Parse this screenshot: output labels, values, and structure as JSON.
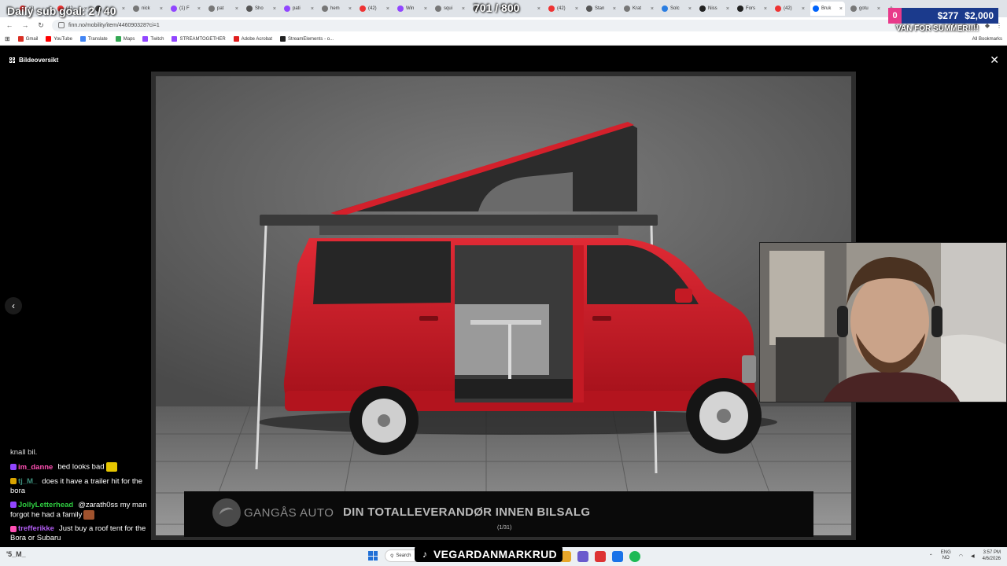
{
  "browser": {
    "tabs": [
      {
        "label": "(3)",
        "color": "#e33"
      },
      {
        "label": "(42",
        "color": "#e33"
      },
      {
        "label": "",
        "color": "#444"
      },
      {
        "label": "nick",
        "color": "#777"
      },
      {
        "label": "(1) F",
        "color": "#9146ff"
      },
      {
        "label": "pat",
        "color": "#777"
      },
      {
        "label": "Sho",
        "color": "#555"
      },
      {
        "label": "pati",
        "color": "#9146ff"
      },
      {
        "label": "hem",
        "color": "#777"
      },
      {
        "label": "(42)",
        "color": "#e33"
      },
      {
        "label": "Win",
        "color": "#9146ff"
      },
      {
        "label": "squi",
        "color": "#777"
      },
      {
        "label": "",
        "color": "#777"
      },
      {
        "label": "",
        "color": "#777"
      },
      {
        "label": "(42)",
        "color": "#e33"
      },
      {
        "label": "Stan",
        "color": "#555"
      },
      {
        "label": "Krat",
        "color": "#777"
      },
      {
        "label": "Solc",
        "color": "#2a7de1"
      },
      {
        "label": "Niss",
        "color": "#222"
      },
      {
        "label": "Fors",
        "color": "#222"
      },
      {
        "label": "(42)",
        "color": "#e33"
      },
      {
        "label": "Bruk",
        "color": "#0063fb",
        "active": true
      },
      {
        "label": "gotu",
        "color": "#777"
      }
    ],
    "url": "finn.no/mobility/item/446090328?ci=1",
    "bookmarks": [
      {
        "label": "Gmail",
        "color": "#d93025"
      },
      {
        "label": "YouTube",
        "color": "#ff0000"
      },
      {
        "label": "Translate",
        "color": "#4285f4"
      },
      {
        "label": "Maps",
        "color": "#34a853"
      },
      {
        "label": "Twitch",
        "color": "#9146ff"
      },
      {
        "label": "STREAMTOGETHER",
        "color": "#9146ff"
      },
      {
        "label": "Adobe Acrobat",
        "color": "#e01e1e"
      },
      {
        "label": "StreamElements - o...",
        "color": "#222"
      }
    ],
    "all_bookmarks": "All Bookmarks"
  },
  "viewer": {
    "title": "Bildeoversikt",
    "banner_brand": "GANGÅS AUTO",
    "banner_tagline": "DIN TOTALLEVERANDØR INNEN BILSALG",
    "image_counter": "(1/31)"
  },
  "overlay": {
    "sub_goal": "Daily sub goal: 2 / 40",
    "counter": "701 / 800",
    "money_zero": "0",
    "money_current": "$277",
    "money_goal": "$2,000",
    "van_goal": "VAN FOR SUMMER!!!!"
  },
  "chat": {
    "cut_text": "knall bil.",
    "messages": [
      {
        "user": "im_danne",
        "text": "bed looks bad",
        "user_color": "#ff4fb3",
        "badge_color": "#9146ff",
        "emote_color": "#e6c600"
      },
      {
        "user": "tj_M_",
        "text": "does it have a trailer hit for the bora",
        "user_color": "#3c8c7a",
        "badge_color": "#d9a400",
        "emote_color": ""
      },
      {
        "user": "JollyLetterhead",
        "text": "@zarath0ss my man forgot he had a family",
        "user_color": "#2ecc40",
        "badge_color": "#9146ff",
        "emote_color": "#a0522d"
      },
      {
        "user": "trefferikke",
        "text": "Just buy a roof tent for the Bora or Subaru",
        "user_color": "#b05cf0",
        "badge_color": "#ff4fb3",
        "emote_color": ""
      }
    ]
  },
  "taskbar": {
    "left_text": "'5_M_",
    "search_label": "Search",
    "tiktok_handle": "VEGARDANMARKRUD",
    "lang_top": "ENG",
    "lang_bottom": "NO",
    "time": "3:57 PM",
    "date": "4/6/2026"
  }
}
